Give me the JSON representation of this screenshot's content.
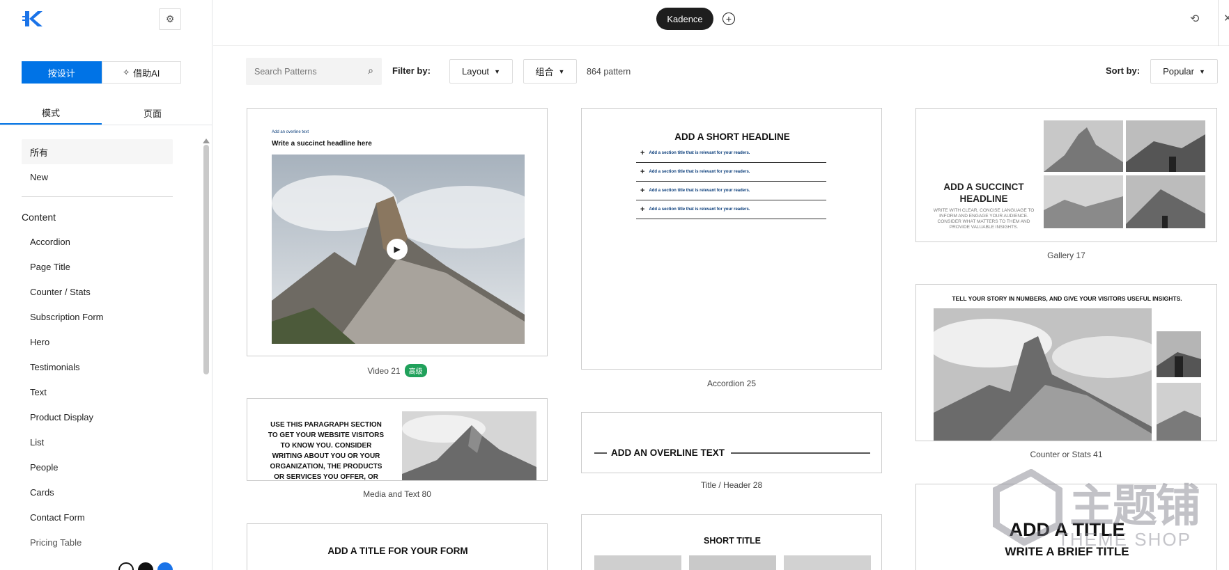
{
  "topbar": {
    "brand_pill": "Kadence"
  },
  "sidebar": {
    "mode_buttons": [
      "按设计",
      "借助AI"
    ],
    "tabs": [
      "模式",
      "页面"
    ],
    "filters": [
      "所有",
      "New"
    ],
    "group_title": "Content",
    "categories": [
      "Accordion",
      "Page Title",
      "Counter / Stats",
      "Subscription Form",
      "Hero",
      "Testimonials",
      "Text",
      "Product Display",
      "List",
      "People",
      "Cards",
      "Contact Form",
      "Pricing Table"
    ]
  },
  "filterbar": {
    "search_placeholder": "Search Patterns",
    "filter_label": "Filter by:",
    "layout_dropdown": "Layout",
    "combo_dropdown": "组合",
    "count_text": "864 pattern",
    "sort_label": "Sort by:",
    "sort_dropdown": "Popular"
  },
  "cards": {
    "video21": {
      "caption": "Video 21",
      "badge": "高级",
      "overline": "Add an overline text",
      "headline": "Write a succinct headline here"
    },
    "media80": {
      "caption": "Media and Text 80",
      "text": "USE THIS PARAGRAPH SECTION TO GET YOUR WEBSITE VISITORS TO KNOW YOU. CONSIDER WRITING ABOUT YOU OR YOUR ORGANIZATION, THE PRODUCTS OR SERVICES YOU OFFER, OR WHY"
    },
    "form": {
      "title": "ADD A TITLE FOR YOUR FORM"
    },
    "accordion25": {
      "caption": "Accordion 25",
      "headline": "ADD A SHORT HEADLINE",
      "rows": [
        "Add a section title that is relevant for your readers.",
        "Add a section title that is relevant for your readers.",
        "Add a section title that is relevant for your readers.",
        "Add a section title that is relevant for your readers."
      ]
    },
    "title28": {
      "caption": "Title / Header 28",
      "text": "ADD AN OVERLINE TEXT"
    },
    "short": {
      "title": "SHORT TITLE"
    },
    "gallery17": {
      "caption": "Gallery 17",
      "headline": "ADD A SUCCINCT HEADLINE",
      "body": "WRITE WITH CLEAR, CONCISE LANGUAGE TO INFORM AND ENGAGE YOUR AUDIENCE. CONSIDER WHAT MATTERS TO THEM AND PROVIDE VALUABLE INSIGHTS."
    },
    "counter41": {
      "caption": "Counter or Stats 41",
      "headline": "TELL YOUR STORY IN NUMBERS, AND GIVE YOUR VISITORS USEFUL INSIGHTS."
    },
    "addtitle": {
      "title": "ADD A TITLE",
      "subtitle": "WRITE A BRIEF TITLE"
    }
  },
  "watermark": {
    "brand_cn": "主题铺",
    "brand_en": "THEME SHOP"
  }
}
